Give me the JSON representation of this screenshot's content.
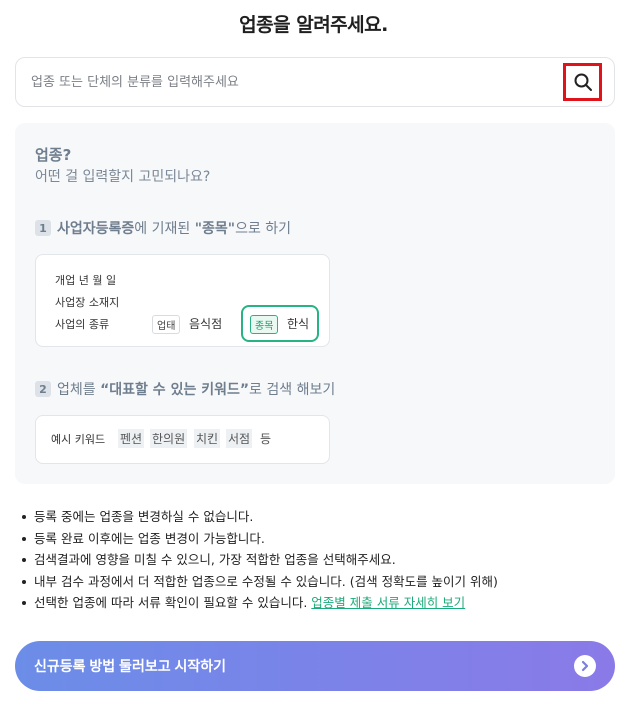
{
  "title": "업종을 알려주세요.",
  "search": {
    "placeholder": "업종 또는 단체의 분류를 입력해주세요",
    "value": ""
  },
  "guide": {
    "heading": "업종?",
    "subheading": "어떤 걸 입력할지 고민되나요?",
    "step1": {
      "num": "1",
      "bold": "사업자등록증",
      "mid": "에 기재된 ",
      "quoted": "\"종목\"",
      "end": "으로 하기"
    },
    "card1": {
      "row1": "개업 년 월 일",
      "row2": "사업장 소재지",
      "row3": "사업의 종류",
      "chip_type": "업태",
      "type_value": "음식점",
      "chip_item": "종목",
      "item_value": "한식"
    },
    "step2": {
      "num": "2",
      "pre": "업체를 ",
      "quoted": "“대표할 수 있는 키워드”",
      "end": "로 검색 해보기"
    },
    "card2": {
      "label": "예시 키워드",
      "keywords": [
        "펜션",
        "한의원",
        "치킨",
        "서점"
      ],
      "suffix": "등"
    }
  },
  "notes": [
    "등록 중에는 업종을 변경하실 수 없습니다.",
    "등록 완료 이후에는 업종 변경이 가능합니다.",
    "검색결과에 영향을 미칠 수 있으니, 가장 적합한 업종을 선택해주세요.",
    "내부 검수 과정에서 더 적합한 업종으로 수정될 수 있습니다. (검색 정확도를 높이기 위해)",
    "선택한 업종에 따라 서류 확인이 필요할 수 있습니다."
  ],
  "notes_link": "업종별 제출 서류 자세히 보기",
  "cta": {
    "label": "신규등록 방법 둘러보고 시작하기"
  },
  "icons": {
    "search": "search-icon",
    "cta_arrow": "chevron-right-icon"
  },
  "colors": {
    "accent_green": "#27b384",
    "cta_start": "#6b8de8",
    "cta_end": "#8a7ae8",
    "search_highlight": "#e0121a"
  }
}
